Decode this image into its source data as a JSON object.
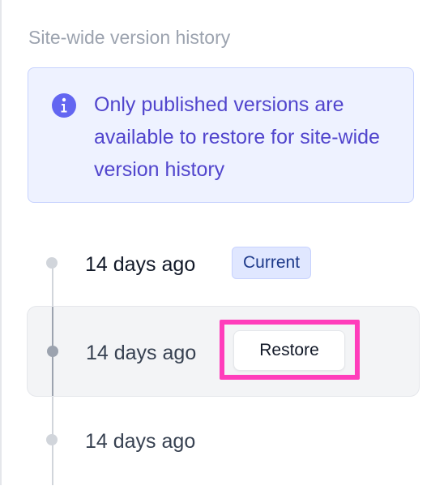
{
  "panel": {
    "heading": "Site-wide version history"
  },
  "info": {
    "icon": "info-circle-icon",
    "message": "Only published versions are available to restore for site-wide version history",
    "color": "#5145cd",
    "background": "#eef2ff"
  },
  "versions": [
    {
      "label": "14 days ago",
      "badge": "Current"
    },
    {
      "label": "14 days ago",
      "restore_label": "Restore",
      "selected": true
    },
    {
      "label": "14 days ago"
    }
  ],
  "colors": {
    "highlight": "#ff3dbb",
    "badge_bg": "#e0e7ff",
    "badge_text": "#1e3a8a"
  }
}
